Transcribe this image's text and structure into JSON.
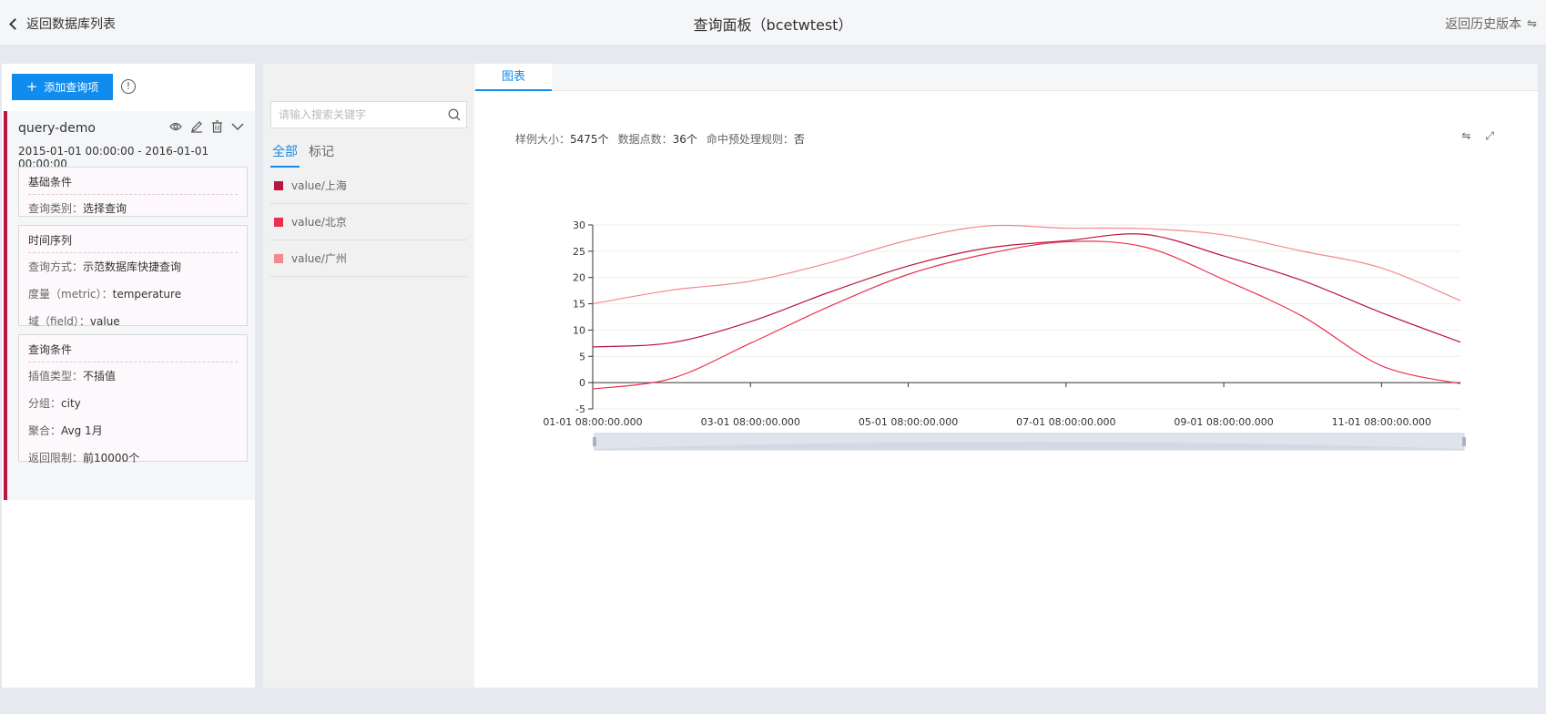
{
  "header": {
    "back_label": "返回数据库列表",
    "title": "查询面板（bcetwtest）",
    "history_label": "返回历史版本",
    "history_icon": "swap-icon"
  },
  "left": {
    "add_button": "添加查询项",
    "info_icon": "info-icon",
    "query": {
      "name": "query-demo",
      "range": "2015-01-01 00:00:00 - 2016-01-01 00:00:00",
      "basic": {
        "title": "基础条件",
        "rows": [
          {
            "k": "查询类别：",
            "v": "选择查询"
          }
        ]
      },
      "timeseries": {
        "title": "时间序列",
        "rows": [
          {
            "k": "查询方式：",
            "v": "示范数据库快捷查询"
          },
          {
            "k": "度量（metric）：",
            "v": "temperature"
          },
          {
            "k": "域（field）：",
            "v": "value"
          }
        ]
      },
      "conditions": {
        "title": "查询条件",
        "rows": [
          {
            "k": "插值类型：",
            "v": "不插值"
          },
          {
            "k": "分组：",
            "v": "city"
          },
          {
            "k": "聚合：",
            "v": "Avg 1月"
          },
          {
            "k": "返回限制：",
            "v": "前10000个"
          }
        ]
      }
    }
  },
  "legend": {
    "search_placeholder": "请输入搜索关键字",
    "tabs": [
      "全部",
      "标记"
    ],
    "items": [
      {
        "label": "value/上海",
        "color": "#b8163e"
      },
      {
        "label": "value/北京",
        "color": "#ee3050"
      },
      {
        "label": "value/广州",
        "color": "#f28a8f"
      }
    ]
  },
  "chart_panel": {
    "tab": "图表",
    "stats": [
      {
        "k": "样例大小：",
        "v": "5475个"
      },
      {
        "k": "数据点数：",
        "v": "36个"
      },
      {
        "k": "命中预处理规则：",
        "v": "否"
      }
    ]
  },
  "chart_data": {
    "type": "line",
    "x": [
      "01-01",
      "02-01",
      "03-01",
      "04-01",
      "05-01",
      "06-01",
      "07-01",
      "08-01",
      "09-01",
      "10-01",
      "11-01",
      "12-01"
    ],
    "xtick_labels": [
      "01-01 08:00:00.000",
      "03-01 08:00:00.000",
      "05-01 08:00:00.000",
      "07-01 08:00:00.000",
      "09-01 08:00:00.000",
      "11-01 08:00:00.000"
    ],
    "ylim": [
      -5,
      30
    ],
    "yticks": [
      -5,
      0,
      5,
      10,
      15,
      20,
      25,
      30
    ],
    "grid": true,
    "series": [
      {
        "name": "value/上海",
        "color": "#b8163e",
        "values": [
          6.8,
          7.6,
          11.6,
          17.2,
          22.2,
          25.6,
          27.0,
          28.2,
          24.1,
          19.4,
          13.3,
          7.7
        ]
      },
      {
        "name": "value/北京",
        "color": "#ee3050",
        "values": [
          -1.2,
          0.8,
          7.5,
          14.5,
          20.6,
          24.5,
          26.8,
          25.8,
          19.6,
          12.6,
          3.2,
          -0.2
        ]
      },
      {
        "name": "value/广州",
        "color": "#f28a8f",
        "values": [
          15.0,
          17.6,
          19.3,
          22.8,
          27.1,
          29.8,
          29.4,
          29.3,
          28.1,
          25.0,
          21.8,
          15.6
        ]
      }
    ]
  }
}
